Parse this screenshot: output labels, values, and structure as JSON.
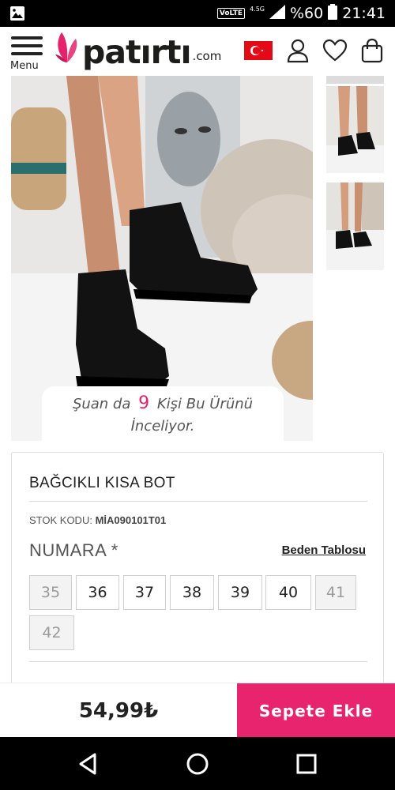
{
  "status_bar": {
    "volte": "VoLTE",
    "network": "4.5G",
    "battery": "%60",
    "time": "21:41"
  },
  "header": {
    "menu_label": "Menu",
    "logo_text": "patırtı",
    "logo_tld": ".com",
    "icons": [
      "turkey-flag-icon",
      "user-icon",
      "heart-icon",
      "bag-icon"
    ]
  },
  "gallery": {
    "viewers_before": "Şuan da",
    "viewers_count": "9",
    "viewers_after_line1": "Kişi Bu Ürünü",
    "viewers_line2": "İnceliyor."
  },
  "product": {
    "title": "BAĞCIKLI KISA BOT",
    "sku_label": "STOK KODU:",
    "sku_value": "MİA090101T01",
    "size_heading": "NUMARA *",
    "size_chart_link": "Beden Tablosu",
    "sizes": [
      {
        "label": "35",
        "available": false
      },
      {
        "label": "36",
        "available": true
      },
      {
        "label": "37",
        "available": true
      },
      {
        "label": "38",
        "available": true
      },
      {
        "label": "39",
        "available": true
      },
      {
        "label": "40",
        "available": true
      },
      {
        "label": "41",
        "available": false
      },
      {
        "label": "42",
        "available": false
      }
    ]
  },
  "purchase": {
    "price": "54,99₺",
    "add_to_cart": "Sepete Ekle"
  },
  "colors": {
    "accent": "#e9246f",
    "flag": "#e30a17"
  }
}
